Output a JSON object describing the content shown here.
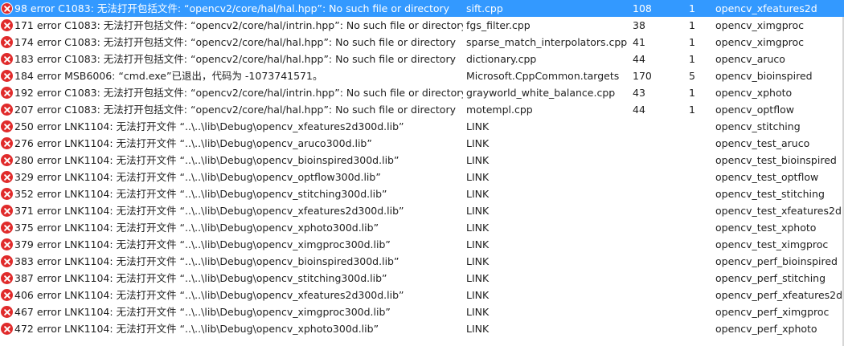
{
  "theme": {
    "selection": "#3399ff",
    "error_icon": "#e02b2b"
  },
  "errors": [
    {
      "desc": "98  error C1083: 无法打开包括文件: “opencv2/core/hal/hal.hpp”: No such file or directory",
      "file": "sift.cpp",
      "line": "108",
      "col": "1",
      "project": "opencv_xfeatures2d",
      "icon": "error-icon",
      "selected": true
    },
    {
      "desc": "171 error C1083: 无法打开包括文件: “opencv2/core/hal/intrin.hpp”: No such file or directory",
      "file": "fgs_filter.cpp",
      "line": "38",
      "col": "1",
      "project": "opencv_ximgproc",
      "icon": "error-icon"
    },
    {
      "desc": "174 error C1083: 无法打开包括文件: “opencv2/core/hal/hal.hpp”: No such file or directory",
      "file": "sparse_match_interpolators.cpp",
      "line": "41",
      "col": "1",
      "project": "opencv_ximgproc",
      "icon": "error-icon"
    },
    {
      "desc": "183 error C1083: 无法打开包括文件: “opencv2/core/hal/hal.hpp”: No such file or directory",
      "file": "dictionary.cpp",
      "line": "44",
      "col": "1",
      "project": "opencv_aruco",
      "icon": "error-icon"
    },
    {
      "desc": "184 error MSB6006: “cmd.exe”已退出，代码为 -1073741571。",
      "file": "Microsoft.CppCommon.targets",
      "line": "170",
      "col": "5",
      "project": "opencv_bioinspired",
      "icon": "error-icon"
    },
    {
      "desc": "192 error C1083: 无法打开包括文件: “opencv2/core/hal/intrin.hpp”: No such file or directory",
      "file": "grayworld_white_balance.cpp",
      "line": "43",
      "col": "1",
      "project": "opencv_xphoto",
      "icon": "error-icon"
    },
    {
      "desc": "207 error C1083: 无法打开包括文件: “opencv2/core/hal/hal.hpp”: No such file or directory",
      "file": "motempl.cpp",
      "line": "44",
      "col": "1",
      "project": "opencv_optflow",
      "icon": "error-icon"
    },
    {
      "desc": "250 error LNK1104: 无法打开文件 “..\\..\\lib\\Debug\\opencv_xfeatures2d300d.lib”",
      "file": "LINK",
      "line": "",
      "col": "",
      "project": "opencv_stitching",
      "icon": "error-icon"
    },
    {
      "desc": "276 error LNK1104: 无法打开文件 “..\\..\\lib\\Debug\\opencv_aruco300d.lib”",
      "file": "LINK",
      "line": "",
      "col": "",
      "project": "opencv_test_aruco",
      "icon": "error-icon"
    },
    {
      "desc": "280 error LNK1104: 无法打开文件 “..\\..\\lib\\Debug\\opencv_bioinspired300d.lib”",
      "file": "LINK",
      "line": "",
      "col": "",
      "project": "opencv_test_bioinspired",
      "icon": "error-icon"
    },
    {
      "desc": "329 error LNK1104: 无法打开文件 “..\\..\\lib\\Debug\\opencv_optflow300d.lib”",
      "file": "LINK",
      "line": "",
      "col": "",
      "project": "opencv_test_optflow",
      "icon": "error-icon"
    },
    {
      "desc": "352 error LNK1104: 无法打开文件 “..\\..\\lib\\Debug\\opencv_stitching300d.lib”",
      "file": "LINK",
      "line": "",
      "col": "",
      "project": "opencv_test_stitching",
      "icon": "error-icon"
    },
    {
      "desc": "371 error LNK1104: 无法打开文件 “..\\..\\lib\\Debug\\opencv_xfeatures2d300d.lib”",
      "file": "LINK",
      "line": "",
      "col": "",
      "project": "opencv_test_xfeatures2d",
      "icon": "error-icon"
    },
    {
      "desc": "375 error LNK1104: 无法打开文件 “..\\..\\lib\\Debug\\opencv_xphoto300d.lib”",
      "file": "LINK",
      "line": "",
      "col": "",
      "project": "opencv_test_xphoto",
      "icon": "error-icon"
    },
    {
      "desc": "379 error LNK1104: 无法打开文件 “..\\..\\lib\\Debug\\opencv_ximgproc300d.lib”",
      "file": "LINK",
      "line": "",
      "col": "",
      "project": "opencv_test_ximgproc",
      "icon": "error-icon"
    },
    {
      "desc": "383 error LNK1104: 无法打开文件 “..\\..\\lib\\Debug\\opencv_bioinspired300d.lib”",
      "file": "LINK",
      "line": "",
      "col": "",
      "project": "opencv_perf_bioinspired",
      "icon": "error-icon"
    },
    {
      "desc": "387 error LNK1104: 无法打开文件 “..\\..\\lib\\Debug\\opencv_stitching300d.lib”",
      "file": "LINK",
      "line": "",
      "col": "",
      "project": "opencv_perf_stitching",
      "icon": "error-icon"
    },
    {
      "desc": "406 error LNK1104: 无法打开文件 “..\\..\\lib\\Debug\\opencv_xfeatures2d300d.lib”",
      "file": "LINK",
      "line": "",
      "col": "",
      "project": "opencv_perf_xfeatures2d",
      "icon": "error-icon"
    },
    {
      "desc": "467 error LNK1104: 无法打开文件 “..\\..\\lib\\Debug\\opencv_ximgproc300d.lib”",
      "file": "LINK",
      "line": "",
      "col": "",
      "project": "opencv_perf_ximgproc",
      "icon": "error-icon"
    },
    {
      "desc": "472 error LNK1104: 无法打开文件 “..\\..\\lib\\Debug\\opencv_xphoto300d.lib”",
      "file": "LINK",
      "line": "",
      "col": "",
      "project": "opencv_perf_xphoto",
      "icon": "error-icon"
    }
  ]
}
